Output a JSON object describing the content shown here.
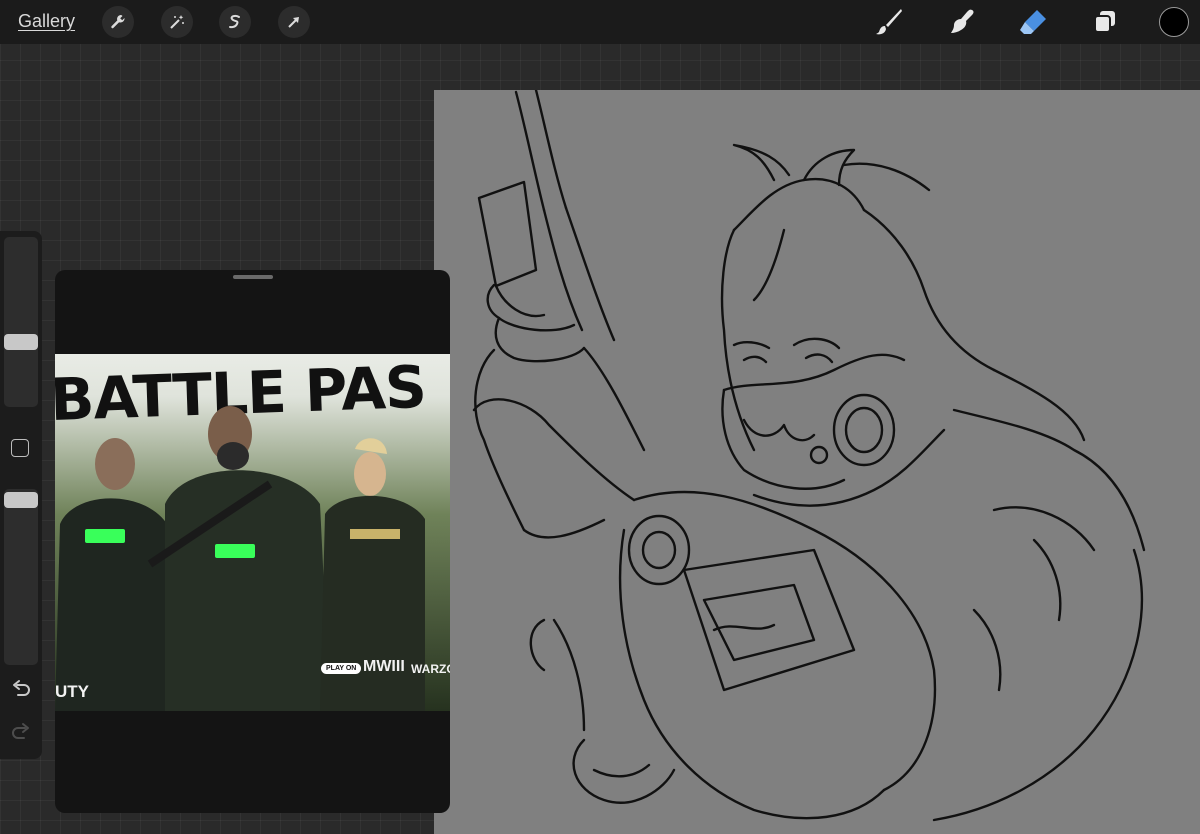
{
  "toolbar": {
    "gallery_label": "Gallery",
    "left_tools": [
      "wrench-icon",
      "magic-wand-icon",
      "selection-icon",
      "transform-arrow-icon"
    ],
    "right_tools": [
      "brush-icon",
      "smudge-icon",
      "eraser-icon",
      "layers-icon"
    ],
    "active_tool": "eraser-icon",
    "active_color": "#000000",
    "accent": "#4a90e2"
  },
  "sidebar": {
    "brush_size_level": 0.35,
    "opacity_level": 0.1
  },
  "reference": {
    "title": "BATTLE PAS",
    "logo_left": "UTY",
    "play_on": "PLAY ON",
    "logo_mw": "MWIII",
    "logo_wz": "WARZO"
  }
}
